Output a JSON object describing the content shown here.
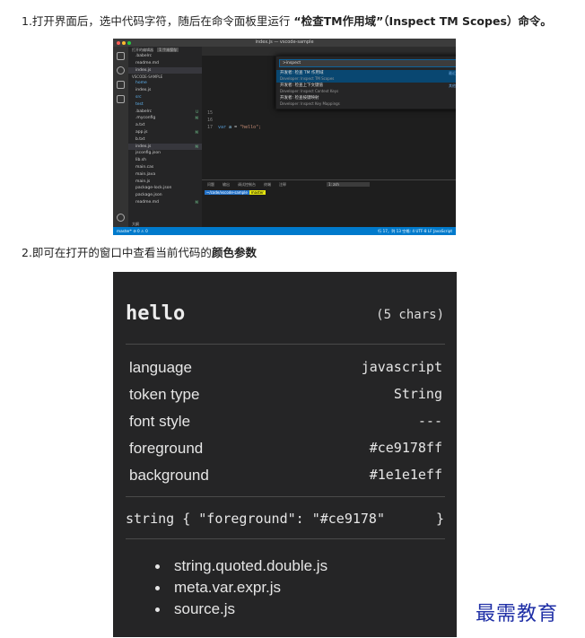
{
  "step1": {
    "prefix": "1.打开界面后，选中代码字符，随后在命令面板里运行 ",
    "command": "“检查TM作用域”（Inspect TM Scopes）命令。"
  },
  "step2": {
    "prefix": "2.即可在打开的窗口中查看当前代码的",
    "bold": "颜色参数"
  },
  "vscode": {
    "title": "index.js — vscode-sample",
    "colors": {
      "activity": "#333333",
      "sidebar": "#252526",
      "editor": "#1e1e1e",
      "status": "#007acc",
      "selection": "#094771"
    },
    "open_editors_label": "打开的编辑器",
    "open_editors_badge": "1 个未保存",
    "open_files": [
      ".babelrc",
      "readme.md",
      "index.js"
    ],
    "folder_label": "VSCODE-SAMPLE",
    "files": [
      {
        "name": "home",
        "folder": true,
        "mark": ""
      },
      {
        "name": "index.js",
        "folder": false,
        "mark": ""
      },
      {
        "name": "src",
        "folder": true,
        "mark": ""
      },
      {
        "name": "test",
        "folder": true,
        "mark": ""
      },
      {
        "name": ".babelrc",
        "folder": false,
        "mark": "U"
      },
      {
        "name": ".myconfig",
        "folder": false,
        "mark": "M"
      },
      {
        "name": "a.txt",
        "folder": false,
        "mark": ""
      },
      {
        "name": "app.js",
        "folder": false,
        "mark": "M"
      },
      {
        "name": "b.txt",
        "folder": false,
        "mark": ""
      },
      {
        "name": "index.js",
        "folder": false,
        "mark": "M"
      },
      {
        "name": "jsconfig.json",
        "folder": false,
        "mark": ""
      },
      {
        "name": "lib.sh",
        "folder": false,
        "mark": ""
      },
      {
        "name": "main.cas",
        "folder": false,
        "mark": ""
      },
      {
        "name": "main.java",
        "folder": false,
        "mark": ""
      },
      {
        "name": "main.js",
        "folder": false,
        "mark": ""
      },
      {
        "name": "package-lock.json",
        "folder": false,
        "mark": ""
      },
      {
        "name": "package.json",
        "folder": false,
        "mark": ""
      },
      {
        "name": "readme.md",
        "folder": false,
        "mark": "M"
      }
    ],
    "outline_label": "大纲",
    "quick_input_value": ">inspect",
    "quick_items": [
      {
        "title": "开发者: 检查 TM 作用域",
        "subtitle": "Developer: Inspect TM Scopes",
        "right": "最近使用",
        "active": true
      },
      {
        "title": "开发者: 检查上下文键值",
        "subtitle": "Developer: Inspect Context Keys",
        "right": "其他命令",
        "active": false
      },
      {
        "title": "开发者: 检查按键映射",
        "subtitle": "Developer: Inspect Key Mappings",
        "right": "",
        "active": false
      }
    ],
    "code_lines": [
      {
        "num": "15",
        "kw": "",
        "var": "",
        "op": "",
        "str": ""
      },
      {
        "num": "16",
        "kw": "",
        "var": "",
        "op": "",
        "str": ""
      },
      {
        "num": "17",
        "kw": "var",
        "var": "a",
        "op": "=",
        "str": "\"hello\";"
      }
    ],
    "panel_tabs": [
      "问题",
      "输出",
      "调试控制台",
      "终端",
      "注释"
    ],
    "terminal_select": "1: zsh",
    "prompt_path": "~/code/vscode-sample",
    "prompt_branch": "master",
    "status_left": "master* ⊘ 0 ⚠ 0",
    "status_right": "行 17，列 13   空格: 4   UTF-8   LF   JavaScript"
  },
  "inspector": {
    "word": "hello",
    "chars": "(5 chars)",
    "props": [
      {
        "key": "language",
        "value": "javascript"
      },
      {
        "key": "token type",
        "value": "String"
      },
      {
        "key": "font style",
        "value": "---"
      },
      {
        "key": "foreground",
        "value": "#ce9178ff"
      },
      {
        "key": "background",
        "value": "#1e1e1eff"
      }
    ],
    "rule": "string { \"foreground\": \"#ce9178\"",
    "rule_end": "}",
    "scopes": [
      "string.quoted.double.js",
      "meta.var.expr.js",
      "source.js"
    ],
    "colors": {
      "panel": "#252526",
      "text": "#e6e6e6",
      "divider": "#4a4a4a"
    }
  },
  "watermark": "最需教育"
}
